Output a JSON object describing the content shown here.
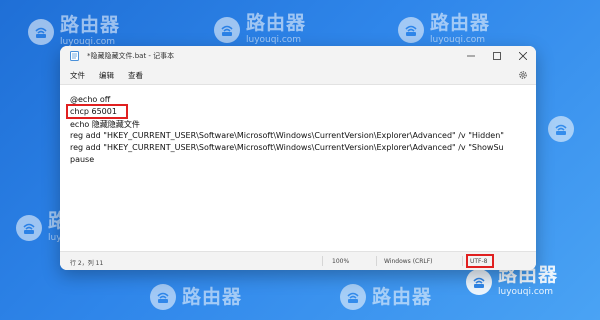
{
  "watermark": {
    "brand_cn": "路由器",
    "brand_url": "luyouqi.com"
  },
  "window": {
    "title": "*隐藏隐藏文件.bat - 记事本",
    "controls": [
      "minimize",
      "maximize",
      "close"
    ]
  },
  "menu": {
    "items": [
      "文件",
      "编辑",
      "查看"
    ]
  },
  "editor": {
    "lines": [
      "@echo off",
      "chcp 65001",
      "echo 隐藏隐藏文件",
      "reg add \"HKEY_CURRENT_USER\\Software\\Microsoft\\Windows\\CurrentVersion\\Explorer\\Advanced\" /v \"Hidden\"",
      "reg add \"HKEY_CURRENT_USER\\Software\\Microsoft\\Windows\\CurrentVersion\\Explorer\\Advanced\" /v \"ShowSu",
      "pause"
    ]
  },
  "statusbar": {
    "position": "行 2，列 11",
    "zoom": "100%",
    "line_ending": "Windows (CRLF)",
    "encoding": "UTF-8"
  },
  "colors": {
    "highlight": "#e02020",
    "desktop": "#2f86ea"
  }
}
